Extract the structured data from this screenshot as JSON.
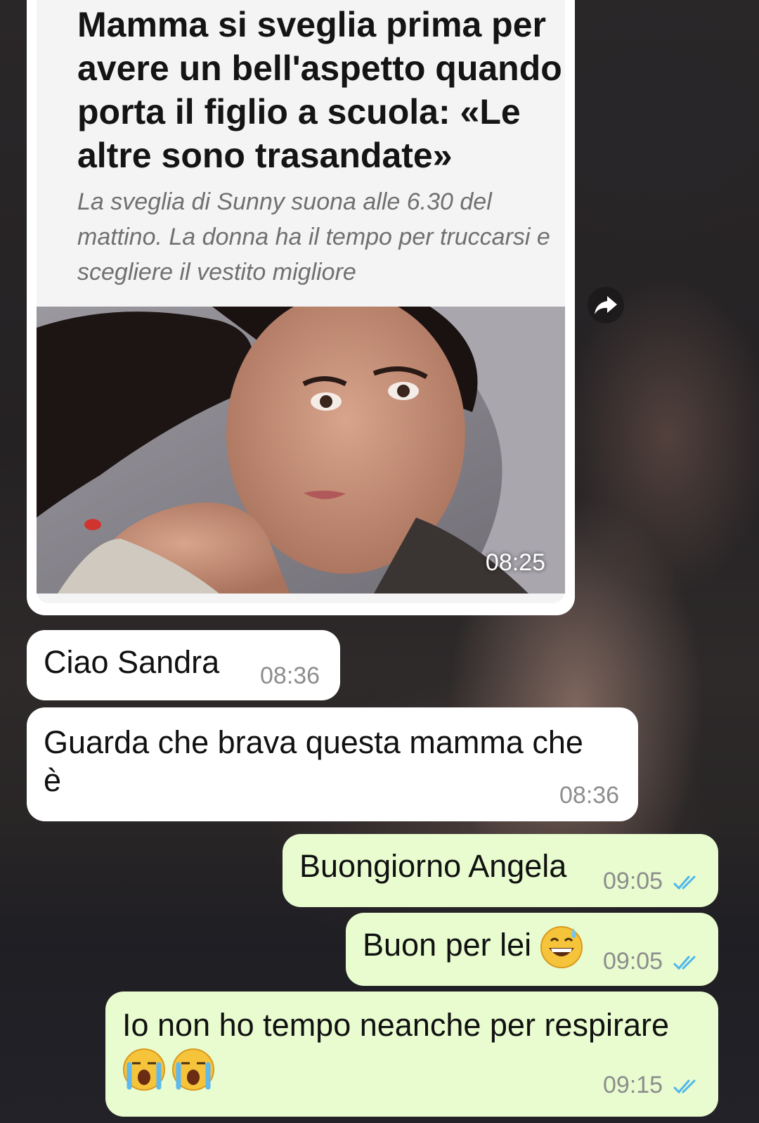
{
  "chat": {
    "link_preview": {
      "headline": "Mamma si sveglia prima per avere un bell'aspetto quando porta il figlio a scuola: «Le altre sono trasandate»",
      "description": "La sveglia di Sunny suona alle 6.30 del mattino. La donna ha il tempo per truccarsi e scegliere il vestito migliore",
      "time": "08:25"
    },
    "messages": [
      {
        "direction": "incoming",
        "text": "Ciao Sandra",
        "time": "08:36"
      },
      {
        "direction": "incoming",
        "text_line1": "Guarda che brava questa mamma che",
        "text_line2": "è",
        "time": "08:36"
      },
      {
        "direction": "outgoing",
        "text": "Buongiorno Angela",
        "time": "09:05",
        "status": "read"
      },
      {
        "direction": "outgoing",
        "text": "Buon per lei",
        "emoji": "grinning-sweat-emoji",
        "time": "09:05",
        "status": "read"
      },
      {
        "direction": "outgoing",
        "text": "Io non ho tempo neanche per respirare",
        "emoji": "loudly-crying-emoji ×2",
        "time": "09:15",
        "status": "read"
      }
    ]
  },
  "colors": {
    "incoming_bubble": "#ffffff",
    "outgoing_bubble": "#e8fccf",
    "timestamp": "#8d8d8d",
    "read_ticks": "#4fb6ec"
  }
}
